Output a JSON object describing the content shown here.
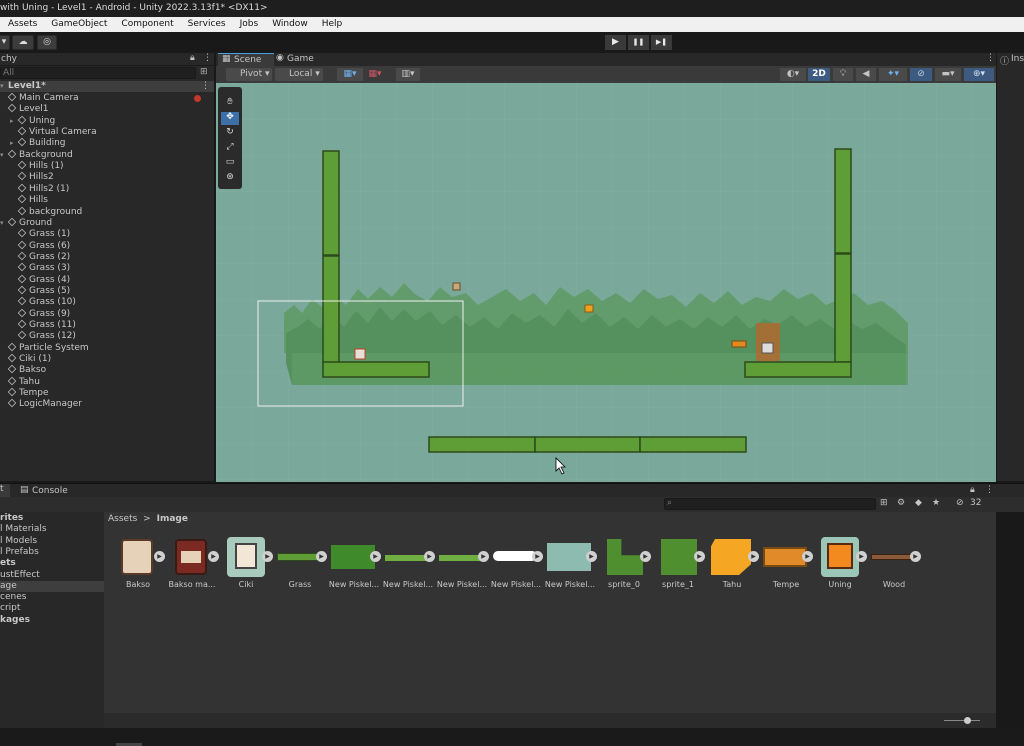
{
  "window": {
    "title": "with Uning - Level1 - Android - Unity 2022.3.13f1* <DX11>"
  },
  "menu": [
    "Assets",
    "GameObject",
    "Component",
    "Services",
    "Jobs",
    "Window",
    "Help"
  ],
  "toolbar": {
    "play": "▶",
    "pause": "❚❚",
    "step": "▶❚"
  },
  "hierarchy": {
    "tab": "chy",
    "search_placeholder": "All",
    "scene_name": "Level1*",
    "items": [
      {
        "label": "Main Camera",
        "depth": 1
      },
      {
        "label": "Level1",
        "depth": 1
      },
      {
        "label": "Uning",
        "depth": 2,
        "arrow": true
      },
      {
        "label": "Virtual Camera",
        "depth": 2
      },
      {
        "label": "Building",
        "depth": 2,
        "arrow": true
      },
      {
        "label": "Background",
        "depth": 1,
        "arrow": true
      },
      {
        "label": "Hills (1)",
        "depth": 2
      },
      {
        "label": "Hills2",
        "depth": 2
      },
      {
        "label": "Hills2 (1)",
        "depth": 2
      },
      {
        "label": "Hills",
        "depth": 2
      },
      {
        "label": "background",
        "depth": 2
      },
      {
        "label": "Ground",
        "depth": 1,
        "arrow": true
      },
      {
        "label": "Grass (1)",
        "depth": 2
      },
      {
        "label": "Grass (6)",
        "depth": 2
      },
      {
        "label": "Grass (2)",
        "depth": 2
      },
      {
        "label": "Grass (3)",
        "depth": 2
      },
      {
        "label": "Grass (4)",
        "depth": 2
      },
      {
        "label": "Grass (5)",
        "depth": 2
      },
      {
        "label": "Grass (10)",
        "depth": 2
      },
      {
        "label": "Grass (9)",
        "depth": 2
      },
      {
        "label": "Grass (11)",
        "depth": 2
      },
      {
        "label": "Grass (12)",
        "depth": 2
      },
      {
        "label": "Particle System",
        "depth": 1
      },
      {
        "label": "Ciki (1)",
        "depth": 1
      },
      {
        "label": "Bakso",
        "depth": 1
      },
      {
        "label": "Tahu",
        "depth": 1
      },
      {
        "label": "Tempe",
        "depth": 1
      },
      {
        "label": "LogicManager",
        "depth": 1
      }
    ]
  },
  "scene": {
    "tabs": [
      "Scene",
      "Game"
    ],
    "pivot": "Pivot",
    "local": "Local",
    "mode2d": "2D"
  },
  "inspector": {
    "tab": "Ins"
  },
  "bottom": {
    "tabs": [
      "t",
      "Console"
    ],
    "hidden_count": "32",
    "breadcrumb_root": "Assets",
    "breadcrumb_sep": ">",
    "breadcrumb_current": "Image",
    "tree": [
      "rites",
      "l Materials",
      "l Models",
      "l Prefabs",
      "ets",
      "ustEffect",
      "age",
      "cenes",
      "cript",
      "kages"
    ],
    "assets": [
      {
        "label": "Bakso",
        "icon": "bakso-sprite"
      },
      {
        "label": "Bakso ma...",
        "icon": "bakso-mangkok-sprite"
      },
      {
        "label": "Ciki",
        "icon": "ciki-sprite"
      },
      {
        "label": "Grass",
        "icon": "grass-sprite"
      },
      {
        "label": "New Piskel...",
        "icon": "grass-block-sprite"
      },
      {
        "label": "New Piskel...",
        "icon": "grass-strip-sprite"
      },
      {
        "label": "New Piskel...",
        "icon": "grass-strip-sprite"
      },
      {
        "label": "New Piskel...",
        "icon": "cloud-sprite"
      },
      {
        "label": "New Piskel...",
        "icon": "background-sprite"
      },
      {
        "label": "sprite_0",
        "icon": "green-shape-sprite"
      },
      {
        "label": "sprite_1",
        "icon": "green-square-sprite"
      },
      {
        "label": "Tahu",
        "icon": "tahu-sprite"
      },
      {
        "label": "Tempe",
        "icon": "tempe-sprite"
      },
      {
        "label": "Uning",
        "icon": "uning-cat-sprite"
      },
      {
        "label": "Wood",
        "icon": "wood-sprite"
      }
    ]
  }
}
